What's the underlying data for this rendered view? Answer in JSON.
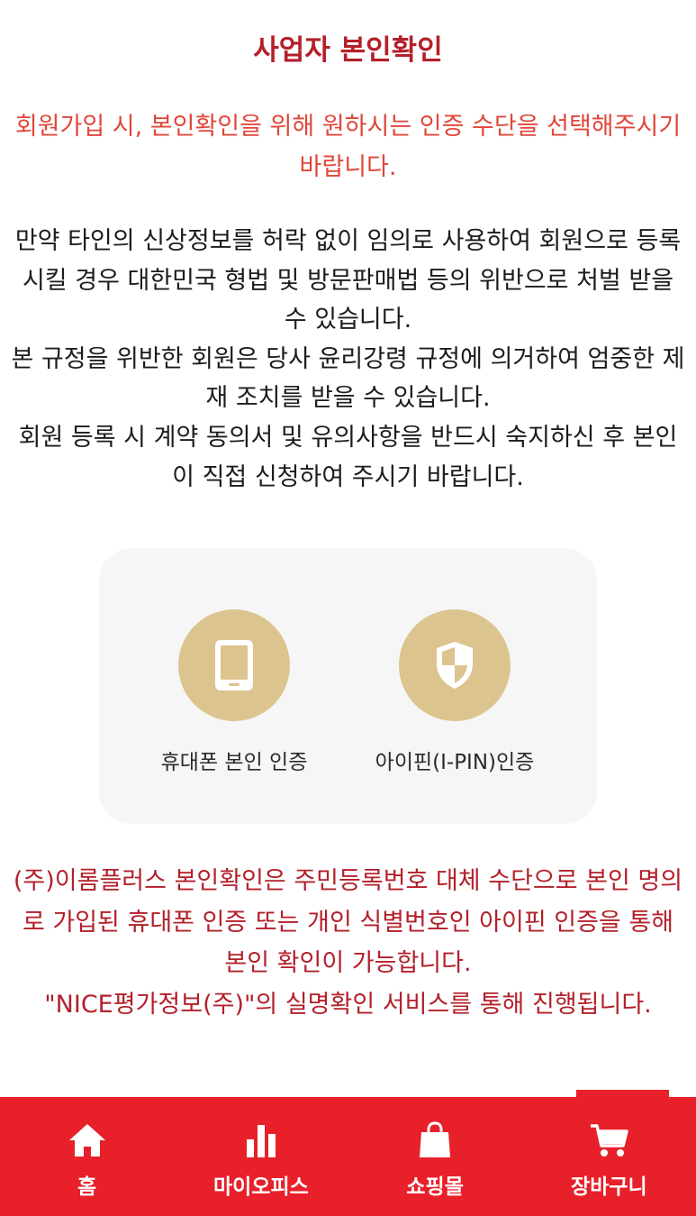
{
  "header": {
    "title": "사업자 본인확인"
  },
  "intro": {
    "text": "회원가입 시, 본인확인을 위해 원하시는 인증 수단을 선택해주시기 바랍니다."
  },
  "notice": {
    "paragraphs": [
      "만약 타인의 신상정보를 허락 없이 임의로 사용하여 회원으로 등록시킬 경우 대한민국 형법 및 방문판매법 등의 위반으로 처벌 받을 수 있습니다.",
      "본 규정을 위반한 회원은 당사 윤리강령 규정에 의거하여 엄중한 제재 조치를 받을 수 있습니다.",
      "회원 등록 시 계약 동의서 및 유의사항을 반드시 숙지하신 후 본인이 직접 신청하여 주시기 바랍니다."
    ]
  },
  "auth_options": [
    {
      "label": "휴대폰 본인 인증",
      "icon": "phone-icon"
    },
    {
      "label": "아이핀(I-PIN)인증",
      "icon": "shield-icon"
    }
  ],
  "footer_note": {
    "paragraphs": [
      "(주)이롬플러스 본인확인은 주민등록번호 대체 수단으로 본인 명의로 가입된 휴대폰 인증 또는 개인 식별번호인 아이핀 인증을 통해 본인 확인이 가능합니다.",
      "\"NICE평가정보(주)\"의 실명확인 서비스를 통해 진행됩니다."
    ]
  },
  "bottom_nav": {
    "items": [
      {
        "label": "홈",
        "icon": "home-icon"
      },
      {
        "label": "마이오피스",
        "icon": "bar-chart-icon"
      },
      {
        "label": "쇼핑몰",
        "icon": "shopping-bag-icon"
      },
      {
        "label": "장바구니",
        "icon": "cart-icon"
      }
    ],
    "active_index": 3
  },
  "colors": {
    "title": "#b3202a",
    "intro": "#e0473a",
    "icon_circle": "#dcc48f",
    "nav_background": "#e8202a"
  }
}
